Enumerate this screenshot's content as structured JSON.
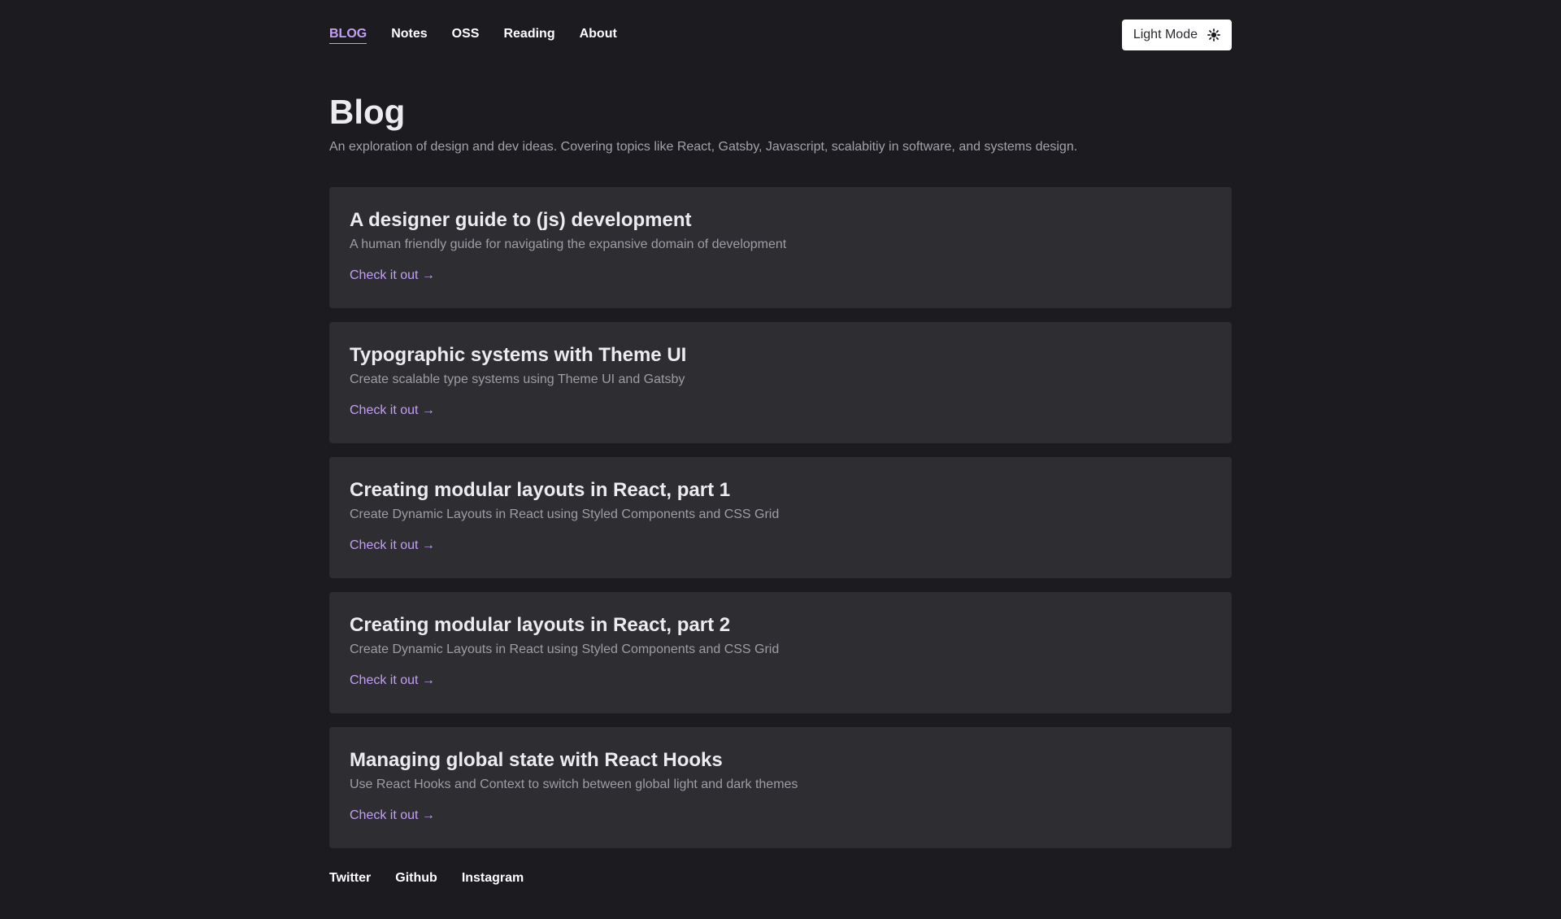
{
  "nav": {
    "items": [
      {
        "label": "BLOG",
        "active": true
      },
      {
        "label": "Notes",
        "active": false
      },
      {
        "label": "OSS",
        "active": false
      },
      {
        "label": "Reading",
        "active": false
      },
      {
        "label": "About",
        "active": false
      }
    ],
    "mode_toggle": {
      "label": "Light Mode",
      "icon": "sun-icon"
    }
  },
  "hero": {
    "title": "Blog",
    "subtitle": "An exploration of design and dev ideas. Covering topics like React, Gatsby, Javascript, scalabitiy in software, and systems design."
  },
  "posts": [
    {
      "title": "A designer guide to (js) development",
      "description": "A human friendly guide for navigating the expansive domain of development",
      "cta": "Check it out →"
    },
    {
      "title": "Typographic systems with Theme UI",
      "description": "Create scalable type systems using Theme UI and Gatsby",
      "cta": "Check it out →"
    },
    {
      "title": "Creating modular layouts in React, part 1",
      "description": "Create Dynamic Layouts in React using Styled Components and CSS Grid",
      "cta": "Check it out →"
    },
    {
      "title": "Creating modular layouts in React, part 2",
      "description": "Create Dynamic Layouts in React using Styled Components and CSS Grid",
      "cta": "Check it out →"
    },
    {
      "title": "Managing global state with React Hooks",
      "description": "Use React Hooks and Context to switch between global light and dark themes",
      "cta": "Check it out →"
    }
  ],
  "footer": {
    "links": [
      "Twitter",
      "Github",
      "Instagram"
    ]
  },
  "colors": {
    "background": "#1c1b20",
    "card": "#2e2d32",
    "accent": "#c39ef5"
  }
}
